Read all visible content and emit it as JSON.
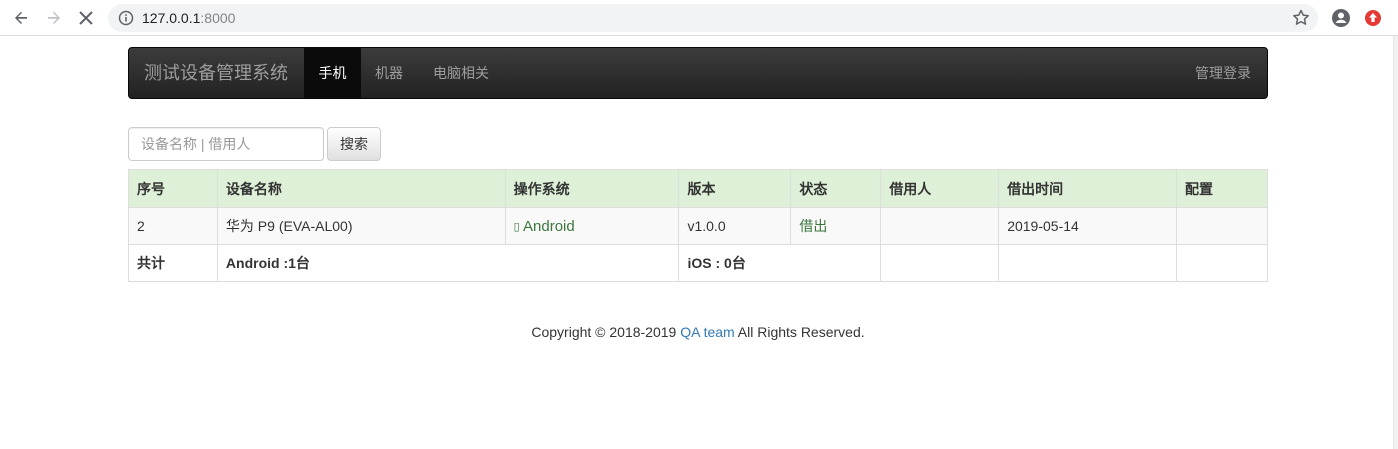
{
  "browser": {
    "url_host": "127.0.0.1",
    "url_port": ":8000"
  },
  "navbar": {
    "brand": "测试设备管理系统",
    "items": [
      {
        "label": "手机",
        "active": true
      },
      {
        "label": "机器",
        "active": false
      },
      {
        "label": "电脑相关",
        "active": false
      }
    ],
    "login_label": "管理登录"
  },
  "search": {
    "placeholder": "设备名称 | 借用人",
    "button_label": "搜索"
  },
  "table": {
    "headers": [
      "序号",
      "设备名称",
      "操作系统",
      "版本",
      "状态",
      "借用人",
      "借出时间",
      "配置"
    ],
    "rows": [
      {
        "index": "2",
        "name": "华为 P9 (EVA-AL00)",
        "os": "Android",
        "version": "v1.0.0",
        "status": "借出",
        "borrower": "",
        "borrow_time": "2019-05-14",
        "config": ""
      }
    ],
    "total": {
      "label": "共计",
      "android": "Android :1台",
      "ios": "iOS : 0台"
    }
  },
  "footer": {
    "prefix": "Copyright © 2018-2019 ",
    "link": "QA team",
    "suffix": " All Rights Reserved."
  },
  "colors": {
    "header_bg": "#dff0d8",
    "success_text": "#3c763d",
    "link": "#337ab7"
  }
}
